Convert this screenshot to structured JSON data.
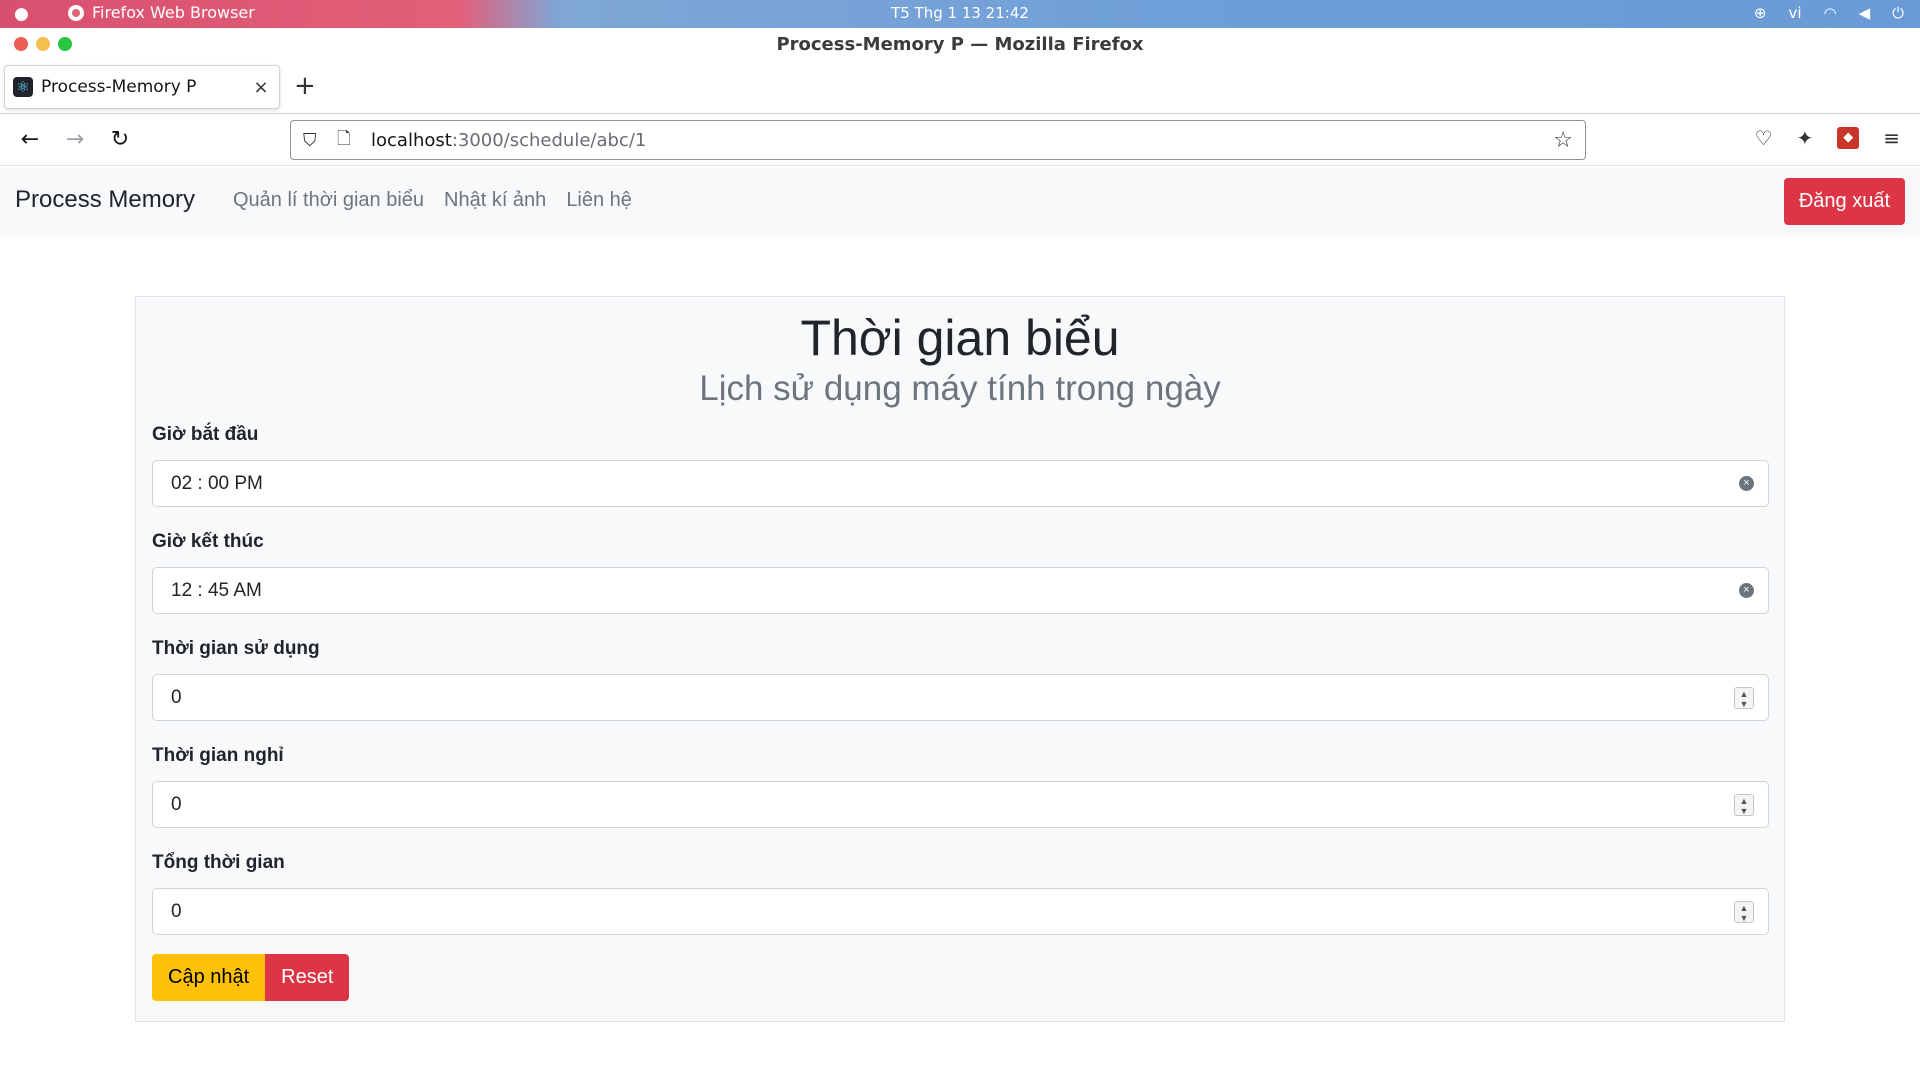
{
  "os": {
    "app_name": "Firefox Web Browser",
    "clock": "T5 Thg 1 13  21:42",
    "lang": "vi"
  },
  "window": {
    "title": "Process-Memory P — Mozilla Firefox"
  },
  "tab": {
    "label": "Process-Memory P",
    "close": "×",
    "favicon": "react-icon"
  },
  "urlbar": {
    "host": "localhost",
    "path": ":3000/schedule/abc/1"
  },
  "app": {
    "brand": "Process Memory",
    "links": [
      "Quản lí thời gian biểu",
      "Nhật kí ảnh",
      "Liên hệ"
    ],
    "logout": "Đăng xuất"
  },
  "card": {
    "title": "Thời gian biểu",
    "subtitle": "Lịch sử dụng máy tính trong ngày",
    "fields": [
      {
        "label": "Giờ bắt đầu",
        "value": "02 : 00   PM",
        "type": "time"
      },
      {
        "label": "Giờ kết thúc",
        "value": "12 : 45   AM",
        "type": "time"
      },
      {
        "label": "Thời gian sử dụng",
        "value": "0",
        "type": "number"
      },
      {
        "label": "Thời gian nghỉ",
        "value": "0",
        "type": "number"
      },
      {
        "label": "Tổng thời gian",
        "value": "0",
        "type": "number"
      }
    ],
    "update_button": "Cập nhật",
    "reset_button": "Reset"
  },
  "colors": {
    "primary_danger": "#dc3545",
    "warning": "#ffc107",
    "nav_bg": "#f8f9fa"
  }
}
